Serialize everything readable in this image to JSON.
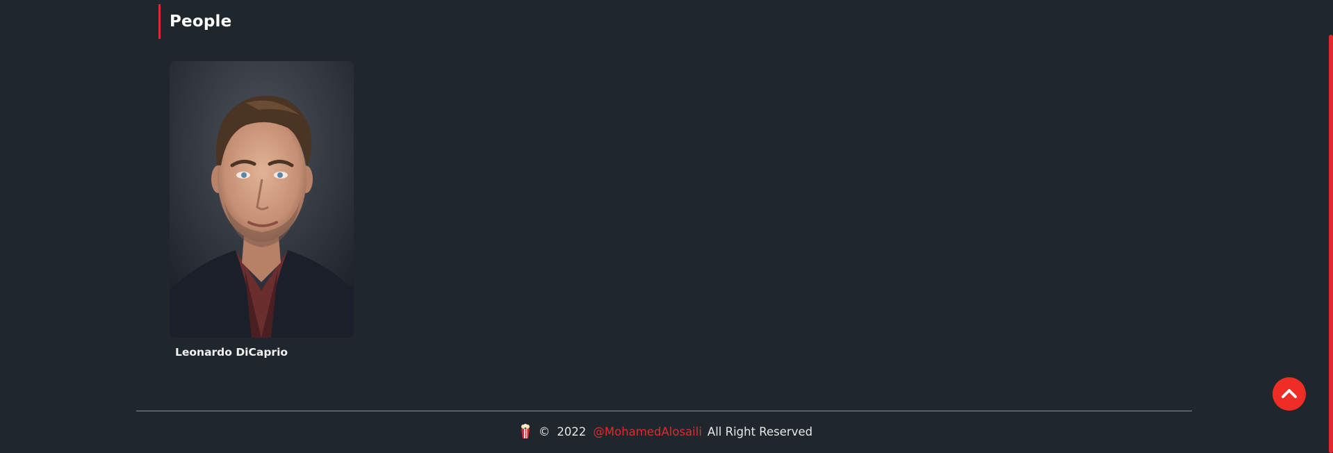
{
  "section": {
    "title": "People"
  },
  "people": [
    {
      "name": "Leonardo DiCaprio"
    }
  ],
  "footer": {
    "icon": "popcorn-icon",
    "copyright": "©",
    "year": "2022",
    "handle": "@MohamedAlosaili",
    "rights": "All Right Reserved"
  },
  "colors": {
    "background": "#1f272d",
    "accent": "#e0282f",
    "scroll_button": "#ee2d26"
  },
  "scroll_top_button": {
    "icon": "chevron-up-icon"
  }
}
